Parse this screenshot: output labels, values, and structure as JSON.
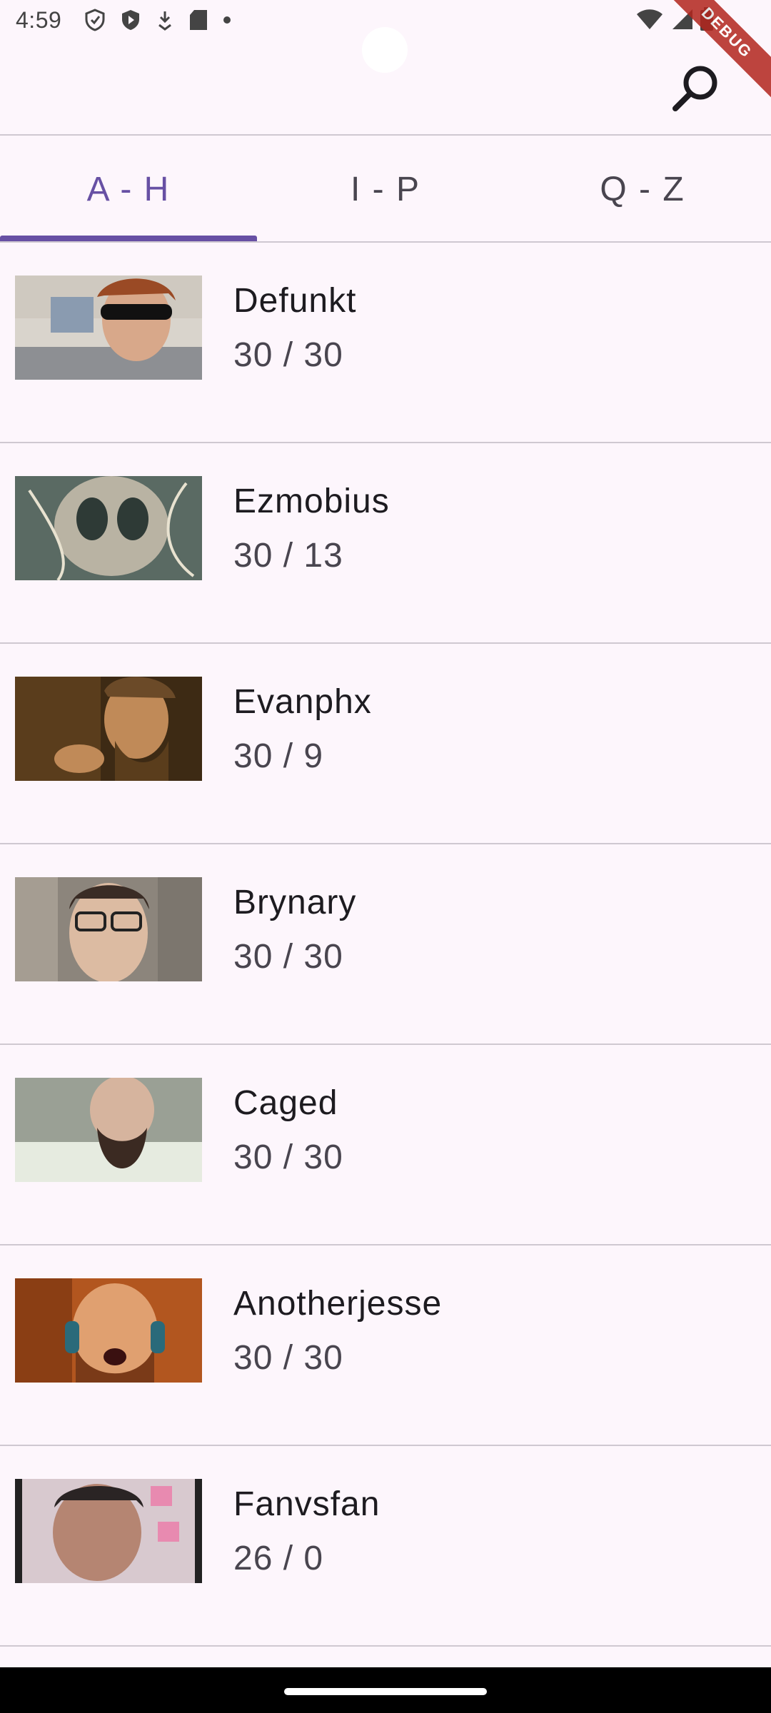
{
  "status_bar": {
    "time": "4:59",
    "icons_left": [
      "shield-outline-icon",
      "shield-play-icon",
      "download-icon",
      "sd-card-icon",
      "dot-icon"
    ],
    "icons_right": [
      "wifi-icon",
      "signal-icon",
      "battery-icon"
    ]
  },
  "debug_banner": {
    "label": "DEBUG"
  },
  "app_bar": {
    "action_icon": "search-icon"
  },
  "tabs": [
    {
      "label": "A - H",
      "active": true
    },
    {
      "label": "I - P",
      "active": false
    },
    {
      "label": "Q - Z",
      "active": false
    }
  ],
  "list": [
    {
      "name": "Defunkt",
      "stats": "30 / 30",
      "avatar_colors": [
        "#7a6a5a",
        "#c8a68a",
        "#3b2a20"
      ]
    },
    {
      "name": "Ezmobius",
      "stats": "30 / 13",
      "avatar_colors": [
        "#6f7f74",
        "#c9c3b3",
        "#2e3a36"
      ]
    },
    {
      "name": "Evanphx",
      "stats": "30 / 9",
      "avatar_colors": [
        "#3d2a14",
        "#b07a48",
        "#1e140a"
      ]
    },
    {
      "name": "Brynary",
      "stats": "30 / 30",
      "avatar_colors": [
        "#8c857c",
        "#d9b9a0",
        "#3a2c25"
      ]
    },
    {
      "name": "Caged",
      "stats": "30 / 30",
      "avatar_colors": [
        "#9aa095",
        "#d6b49e",
        "#3b2a22"
      ]
    },
    {
      "name": "Anotherjesse",
      "stats": "30 / 30",
      "avatar_colors": [
        "#b2561f",
        "#e0a070",
        "#2a1a10"
      ]
    },
    {
      "name": "Fanvsfan",
      "stats": "26 / 0",
      "avatar_colors": [
        "#d8c9cf",
        "#b58572",
        "#2a2424"
      ]
    }
  ],
  "colors": {
    "background": "#fdf6fc",
    "accent": "#6750a4",
    "divider": "#cfc8d1",
    "debug": "#b3261e"
  }
}
